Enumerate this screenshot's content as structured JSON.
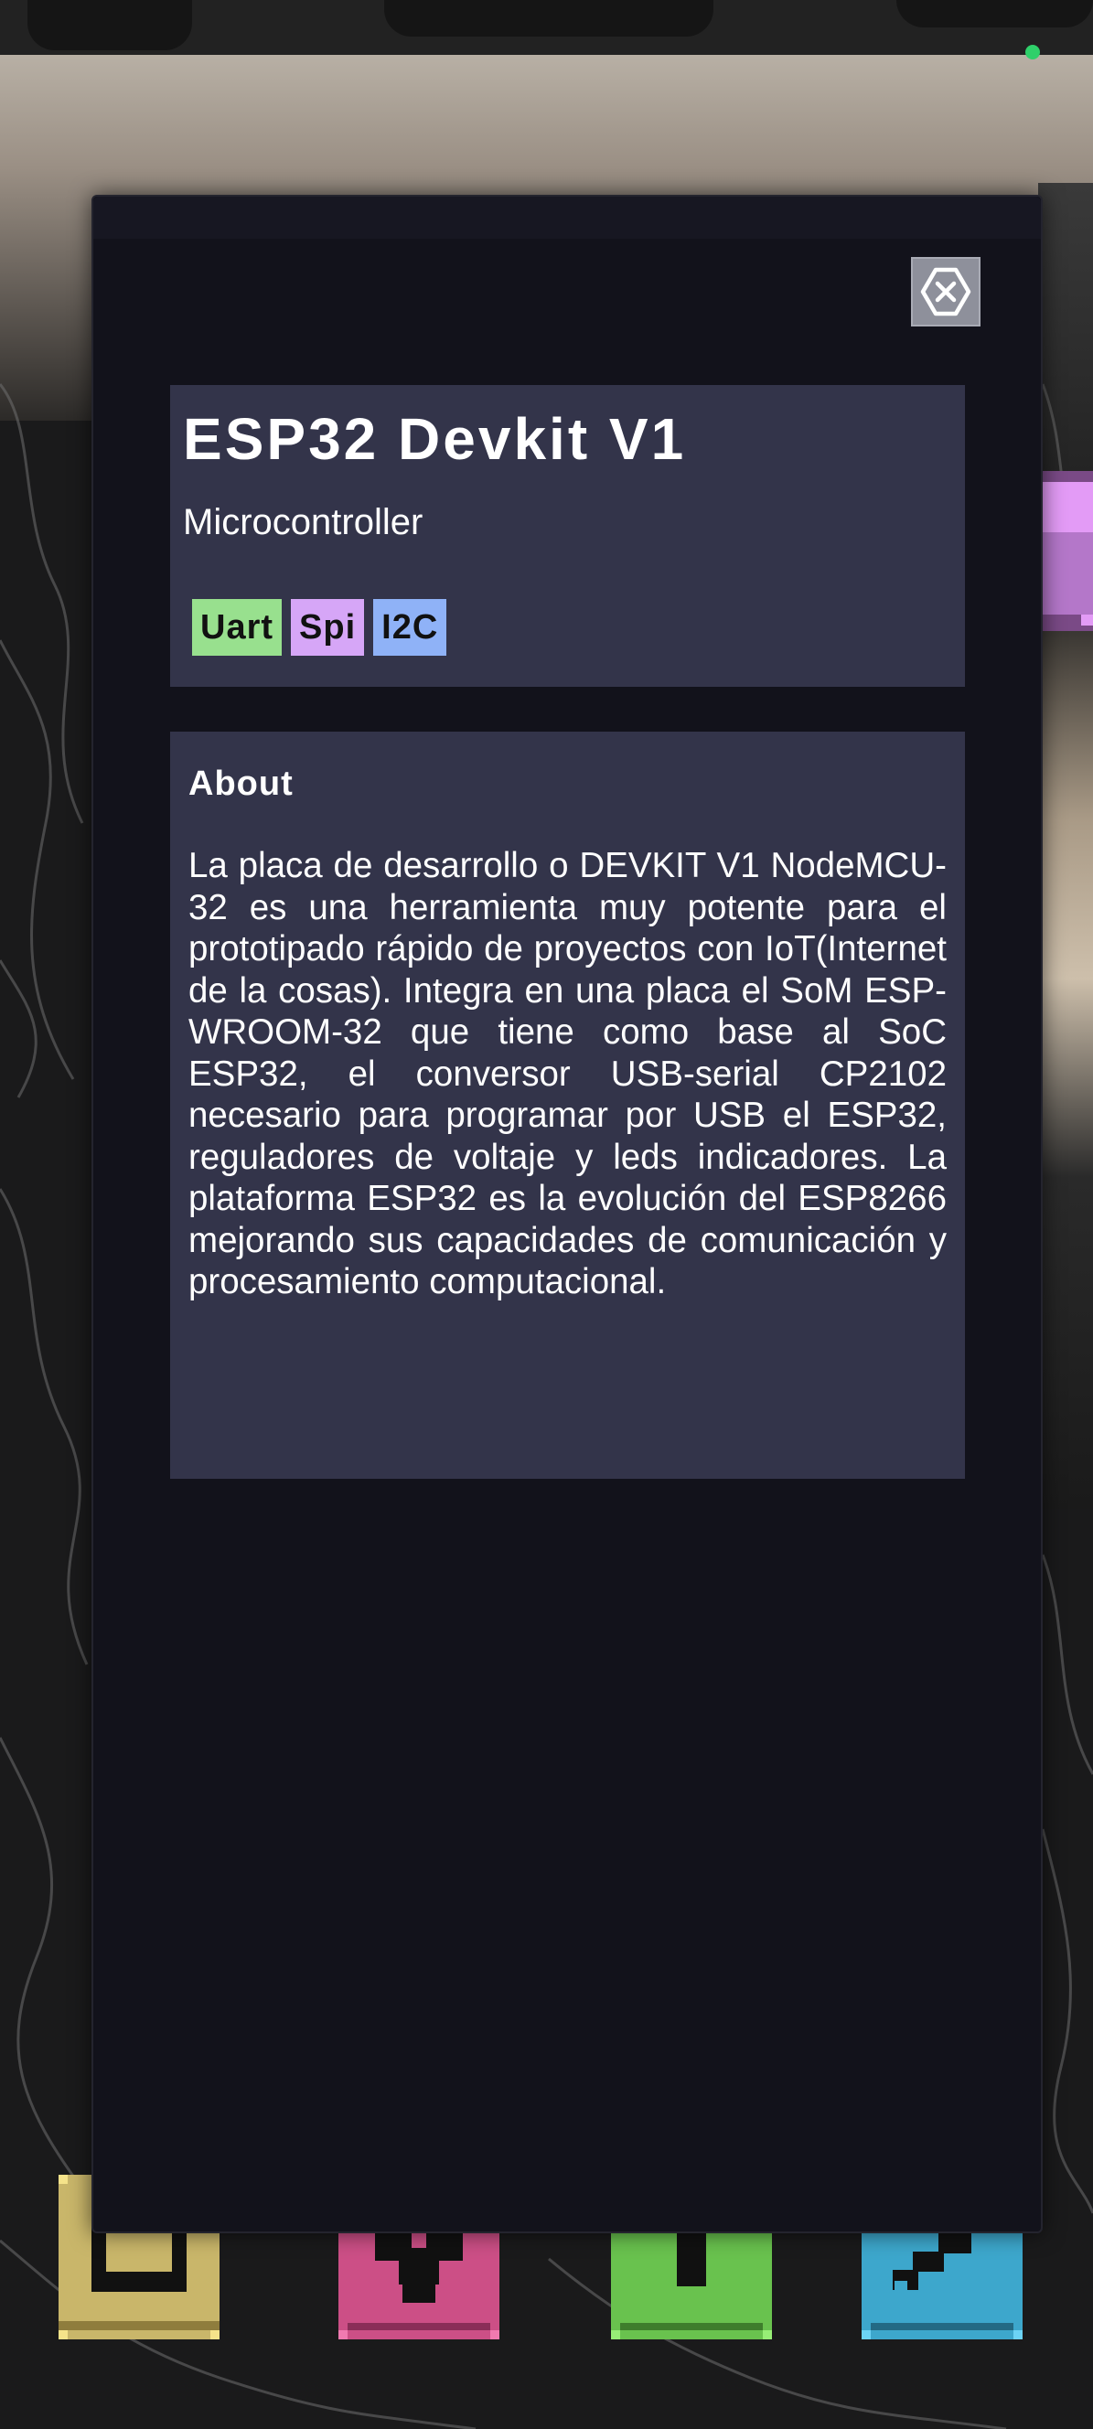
{
  "device": {
    "title": "ESP32 Devkit V1",
    "category": "Microcontroller",
    "tags": [
      {
        "label": "Uart",
        "color": "#98e08e"
      },
      {
        "label": "Spi",
        "color": "#d6a6f7"
      },
      {
        "label": "I2C",
        "color": "#8fb2f7"
      }
    ]
  },
  "about": {
    "heading": "About",
    "text": "La placa de desarrollo o DEVKIT V1 NodeMCU-32 es una herramienta muy potente para el prototipado rápido de proyectos con IoT(Internet de la cosas). Integra en una placa el SoM ESP-WROOM-32 que tiene como base al SoC ESP32, el conversor USB-serial CP2102 necesario para programar por USB el ESP32, reguladores de voltaje y leds indicadores. La plataforma ESP32 es la evolución del ESP8266 mejorando sus capacidades de comunicación y procesamiento computacional."
  },
  "icons": {
    "close": "close-icon",
    "toolbar": [
      "inventory-box-icon",
      "gear-icon",
      "mushroom-icon",
      "wrench-icon"
    ],
    "side": "purple-block-icon"
  },
  "colors": {
    "modal_bg": "#12121b",
    "card_bg": "#33344a",
    "status_dot": "#2fd06a",
    "tile_yellow": "#c9b66a",
    "tile_pink": "#cc4f86",
    "tile_green": "#69c24e",
    "tile_blue": "#3da7cc"
  }
}
